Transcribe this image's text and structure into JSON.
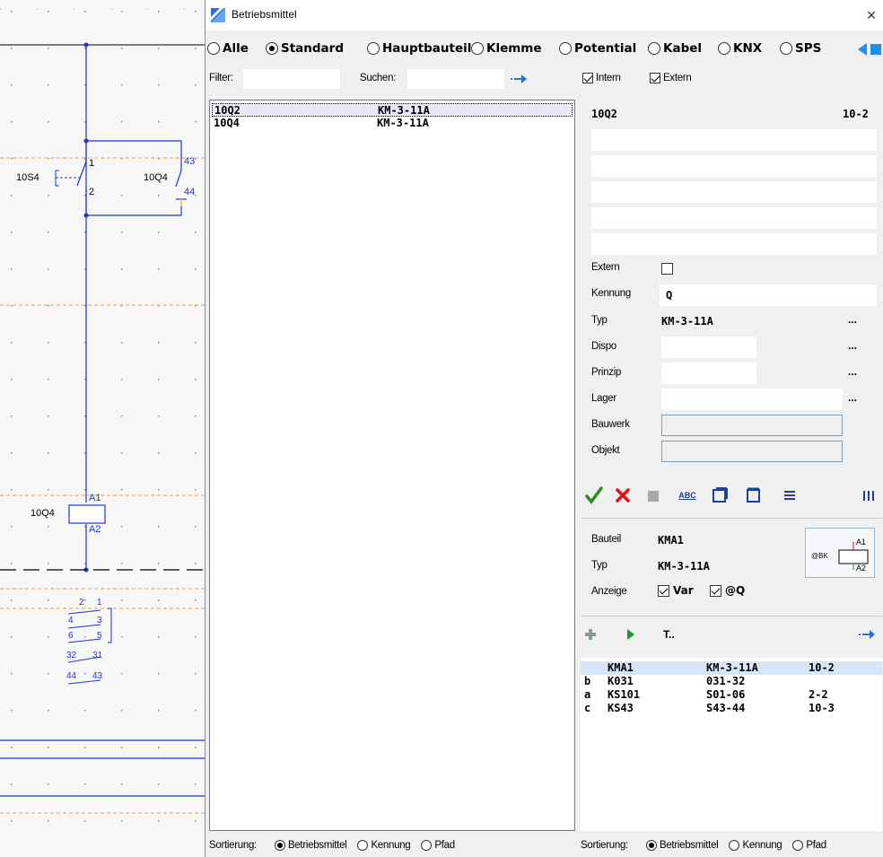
{
  "schematic": {
    "labels": {
      "s4": "10S4",
      "q4_top": "10Q4",
      "q4_coil": "10Q4",
      "pin1": "1",
      "pin2": "2",
      "pin43": "43",
      "pin44": "44",
      "a1": "A1",
      "a2": "A2",
      "c2": "2",
      "c1": "1",
      "c4": "4",
      "c3": "3",
      "c6": "6",
      "c5": "5",
      "c32": "32",
      "c31": "31",
      "c44": "44",
      "c43": "43"
    }
  },
  "dialog": {
    "title": "Betriebsmittel",
    "close": "×",
    "filter_radios": [
      {
        "label": "Alle",
        "selected": false
      },
      {
        "label": "Standard",
        "selected": true
      },
      {
        "label": "Hauptbauteil",
        "selected": false
      },
      {
        "label": "Klemme",
        "selected": false
      },
      {
        "label": "Potential",
        "selected": false
      },
      {
        "label": "Kabel",
        "selected": false
      },
      {
        "label": "KNX",
        "selected": false
      },
      {
        "label": "SPS",
        "selected": false
      }
    ],
    "filter_label": "Filter:",
    "filter_value": "",
    "search_label": "Suchen:",
    "search_value": "",
    "intern_label": "Intern",
    "intern_checked": true,
    "extern_label": "Extern",
    "extern_checked": true
  },
  "left_list": {
    "rows": [
      {
        "name": "10Q2",
        "type": "KM-3-11A",
        "selected": true
      },
      {
        "name": "10Q4",
        "type": "KM-3-11A",
        "selected": false
      }
    ],
    "sort_label": "Sortierung:",
    "sort_options": [
      "Betriebsmittel",
      "Kennung",
      "Pfad"
    ],
    "sort_selected": "Betriebsmittel"
  },
  "details": {
    "name": "10Q2",
    "path": "10-2",
    "extern_label": "Extern",
    "kennung_label": "Kennung",
    "kennung_value": "Q",
    "typ_label": "Typ",
    "typ_value": "KM-3-11A",
    "dispo_label": "Dispo",
    "prinzip_label": "Prinzip",
    "lager_label": "Lager",
    "bauwerk_label": "Bauwerk",
    "objekt_label": "Objekt",
    "ellipsis": "..."
  },
  "toolbar": {
    "abc": "ABC"
  },
  "bauteil": {
    "bauteil_label": "Bauteil",
    "bauteil_value": "KMA1",
    "typ_label": "Typ",
    "typ_value": "KM-3-11A",
    "anzeige_label": "Anzeige",
    "var_label": "Var",
    "var_checked": true,
    "q_label": "@Q",
    "q_checked": true,
    "preview": {
      "bk": "@BK",
      "a1": "A1",
      "a2": "A2"
    }
  },
  "bottom_toolbar": {
    "t_label": "T.."
  },
  "right_list": {
    "rows": [
      {
        "prefix": "",
        "name": "KMA1",
        "type": "KM-3-11A",
        "path": "10-2",
        "selected": true
      },
      {
        "prefix": "b",
        "name": "K031",
        "type": "031-32",
        "path": "",
        "selected": false
      },
      {
        "prefix": "a",
        "name": "KS101",
        "type": "S01-06",
        "path": "2-2",
        "selected": false
      },
      {
        "prefix": "c",
        "name": "KS43",
        "type": "S43-44",
        "path": "10-3",
        "selected": false
      }
    ],
    "sort_label": "Sortierung:",
    "sort_options": [
      "Betriebsmittel",
      "Kennung",
      "Pfad"
    ],
    "sort_selected": "Betriebsmittel"
  },
  "colors": {
    "accent": "#1e73e8",
    "check_green": "#2e8b1e",
    "delete_red": "#e01010",
    "schematic_blue": "#2233cc",
    "dash_orange": "#f0a040"
  }
}
